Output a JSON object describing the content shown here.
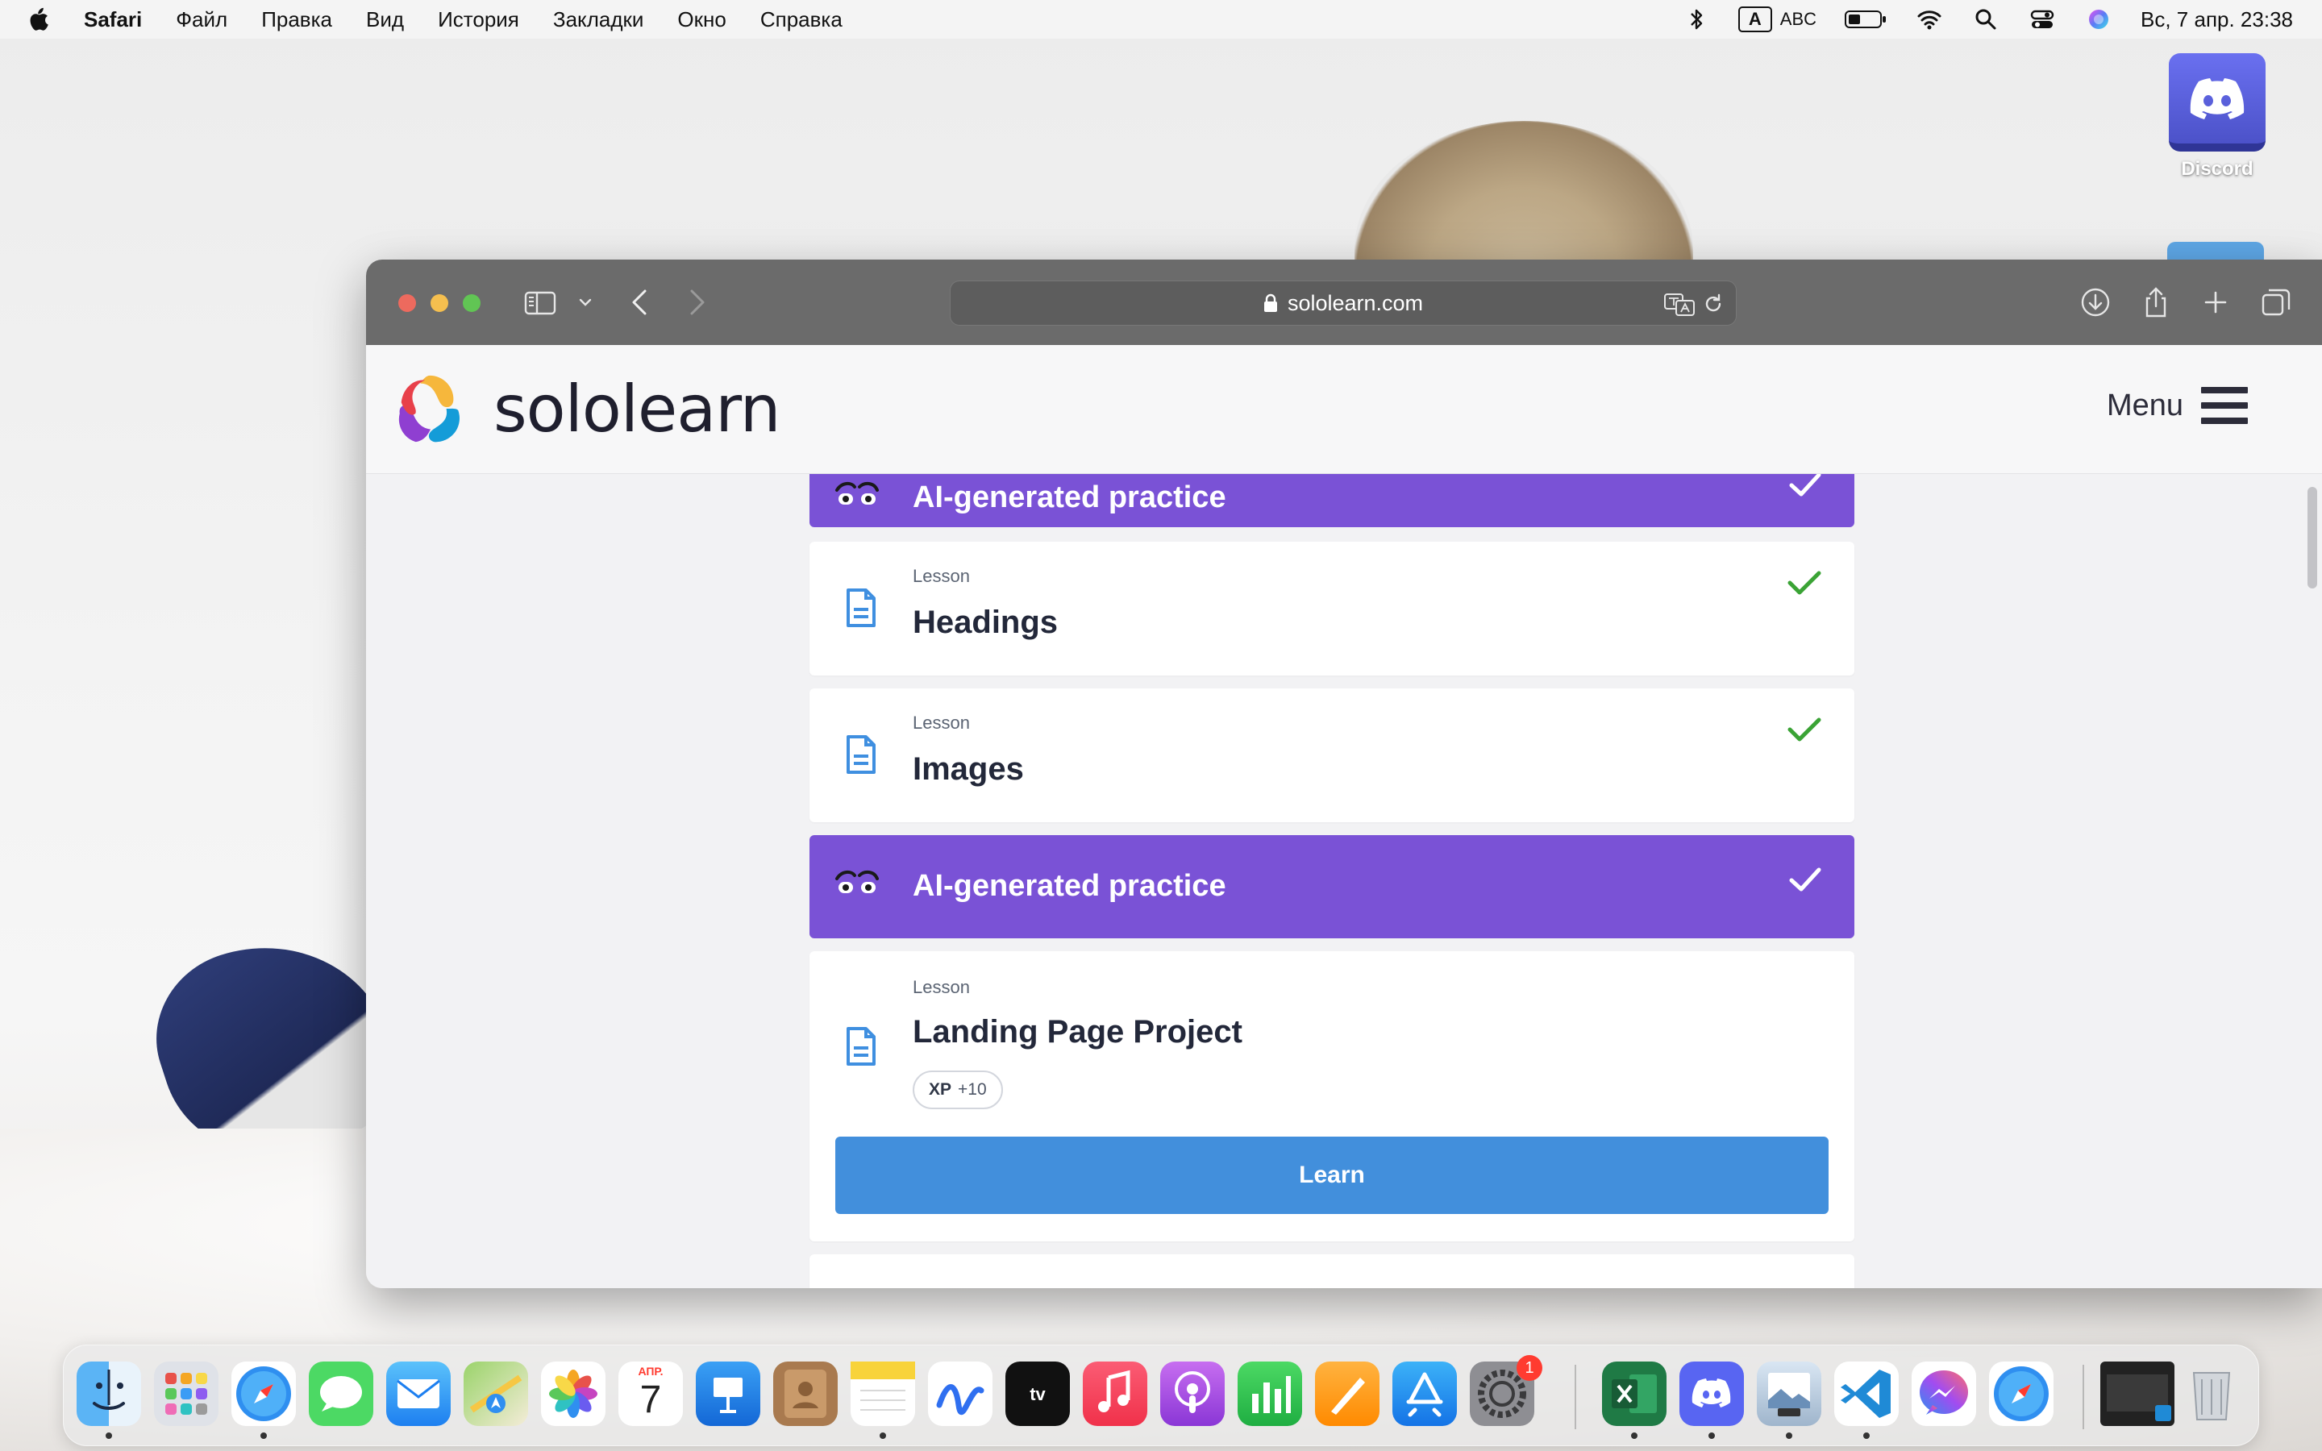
{
  "menubar": {
    "app": "Safari",
    "items": [
      "Файл",
      "Правка",
      "Вид",
      "История",
      "Закладки",
      "Окно",
      "Справка"
    ],
    "input_indicator": "A",
    "input_source": "ABC",
    "clock": "Вс, 7 апр.  23:38"
  },
  "desktop": {
    "icon_label": "Discord"
  },
  "browser": {
    "url": "sololearn.com"
  },
  "site": {
    "brand": "sololearn",
    "menu_label": "Menu"
  },
  "lesson_list": {
    "practice_title": "AI-generated practice",
    "lessons": [
      {
        "kind": "Lesson",
        "title": "Headings",
        "completed": true
      },
      {
        "kind": "Lesson",
        "title": "Images",
        "completed": true
      }
    ],
    "practice_title_2": "AI-generated practice",
    "project": {
      "kind": "Lesson",
      "title": "Landing Page Project",
      "xp_label": "XP",
      "xp_value": "+10",
      "button": "Learn"
    }
  },
  "dock": {
    "calendar_month": "АПР.",
    "calendar_day": "7",
    "settings_badge": "1",
    "apps": [
      "finder-icon",
      "launchpad-icon",
      "safari-icon",
      "messages-icon",
      "mail-icon",
      "maps-icon",
      "photos-icon",
      "calendar-icon",
      "keynote-icon",
      "contacts-icon",
      "notes-icon",
      "freeform-icon",
      "apple-tv-icon",
      "music-icon",
      "podcasts-icon",
      "numbers-icon",
      "pages-icon",
      "app-store-icon",
      "system-settings-icon",
      "excel-icon",
      "discord-icon",
      "preview-icon",
      "vscode-icon",
      "messenger-icon",
      "safari-alt-icon",
      "screenshot-icon",
      "trash-icon"
    ]
  },
  "colors": {
    "purple": "#7a52d6",
    "learn_blue": "#428fdc",
    "check_green": "#3aa335",
    "toolbar": "#6b6b6b"
  }
}
